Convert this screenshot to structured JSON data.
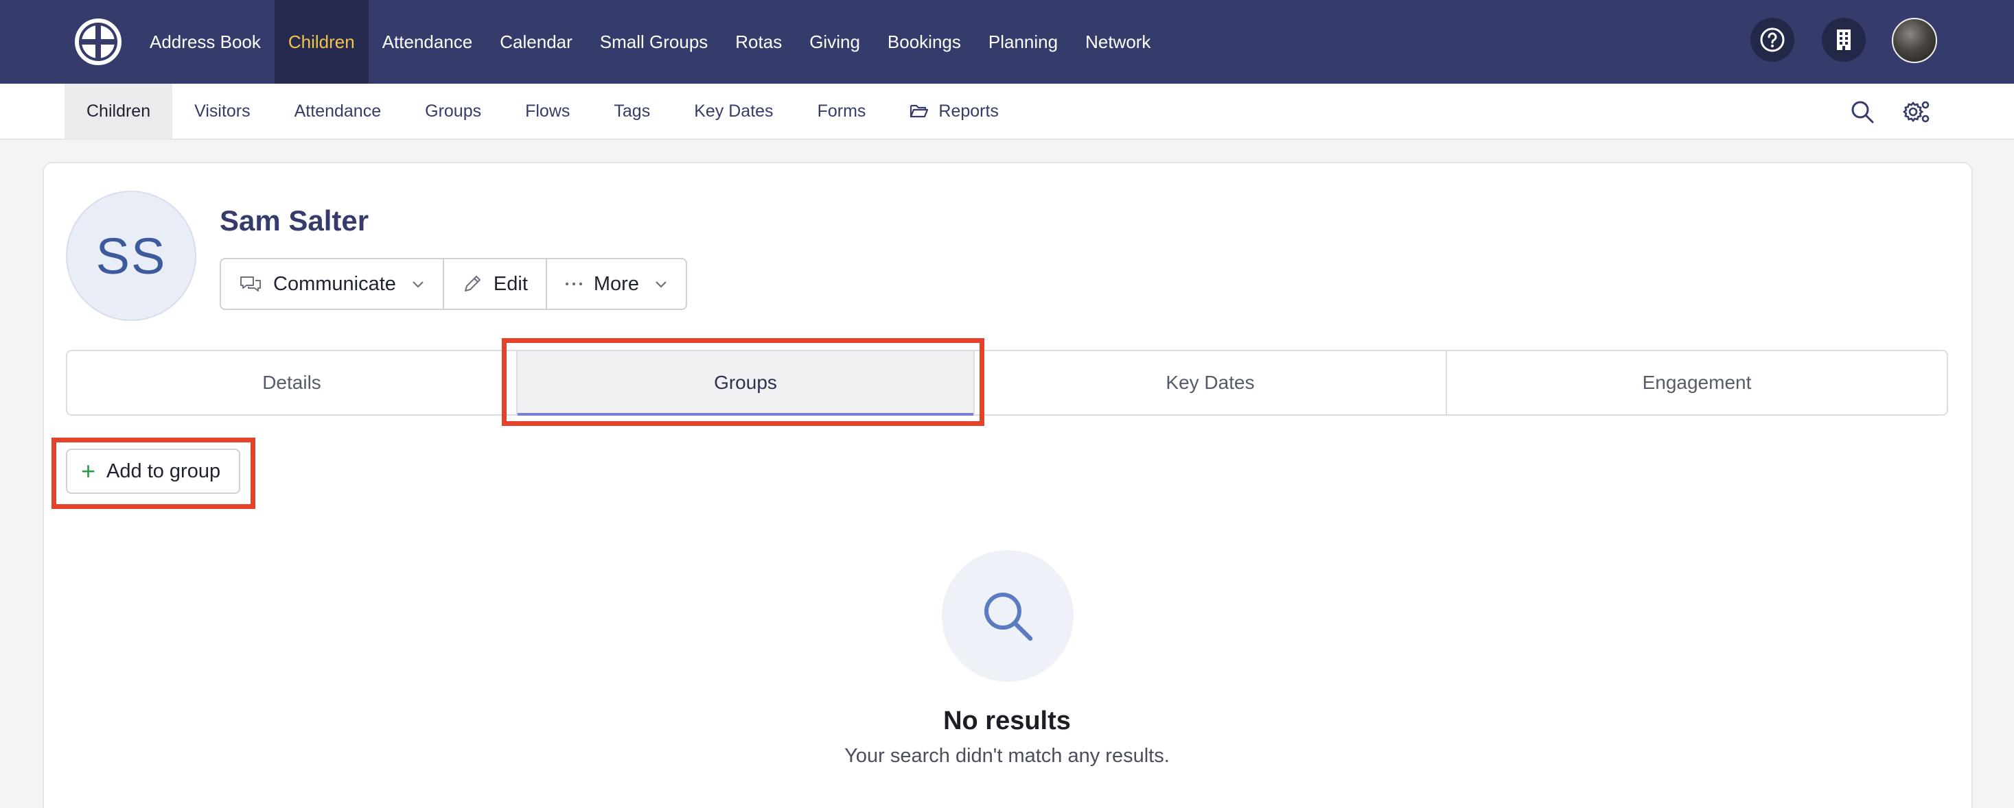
{
  "topnav": {
    "items": [
      {
        "label": "Address Book"
      },
      {
        "label": "Children"
      },
      {
        "label": "Attendance"
      },
      {
        "label": "Calendar"
      },
      {
        "label": "Small Groups"
      },
      {
        "label": "Rotas"
      },
      {
        "label": "Giving"
      },
      {
        "label": "Bookings"
      },
      {
        "label": "Planning"
      },
      {
        "label": "Network"
      }
    ],
    "active_index": 1,
    "icons": [
      "help-icon",
      "building-icon"
    ],
    "active_color": "#f1c34a",
    "background": "#353b6a"
  },
  "subnav": {
    "items": [
      {
        "label": "Children"
      },
      {
        "label": "Visitors"
      },
      {
        "label": "Attendance"
      },
      {
        "label": "Groups"
      },
      {
        "label": "Flows"
      },
      {
        "label": "Tags"
      },
      {
        "label": "Key Dates"
      },
      {
        "label": "Forms"
      },
      {
        "label": "Reports",
        "icon": "folder-open-icon"
      }
    ],
    "active_index": 0,
    "tools": [
      "search-icon",
      "settings-icon"
    ]
  },
  "profile": {
    "initials": "SS",
    "name": "Sam Salter",
    "actions": {
      "communicate": "Communicate",
      "edit": "Edit",
      "more": "More"
    }
  },
  "tabs": {
    "details": "Details",
    "groups": "Groups",
    "key_dates": "Key Dates",
    "engagement": "Engagement",
    "active": "Groups"
  },
  "add_to_group": "Add to group",
  "empty_state": {
    "title": "No results",
    "message": "Your search didn't match any results."
  },
  "highlight_color": "#e4432a"
}
